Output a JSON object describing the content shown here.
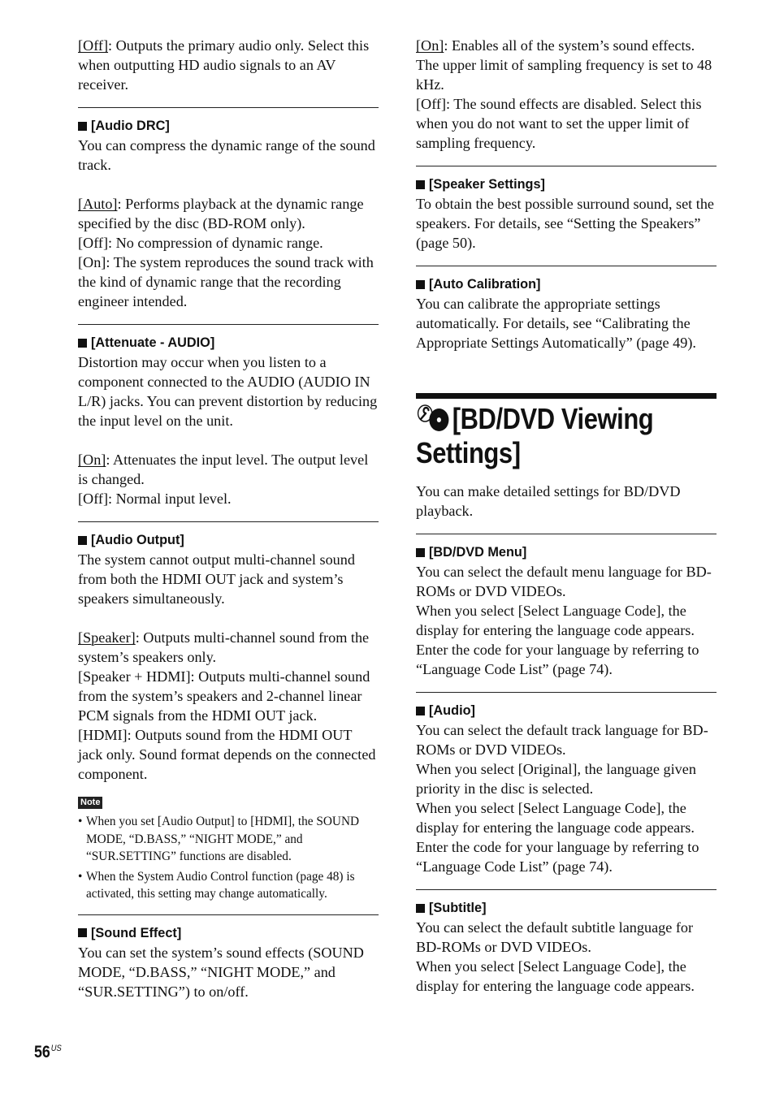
{
  "left": {
    "intro": {
      "opt": "[Off]",
      "rest": ": Outputs the primary audio only. Select this when outputting HD audio signals to an AV receiver."
    },
    "audio_drc": {
      "heading": "[Audio DRC]",
      "desc": "You can compress the dynamic range of the sound track.",
      "opt1": "[Auto]",
      "opt1_rest": ": Performs playback at the dynamic range specified by the disc (BD-ROM only).",
      "opt2": "[Off]: No compression of dynamic range.",
      "opt3": "[On]: The system reproduces the sound track with the kind of dynamic range that the recording engineer intended."
    },
    "attenuate": {
      "heading": "[Attenuate - AUDIO]",
      "desc": "Distortion may occur when you listen to a component connected to the AUDIO (AUDIO IN L/R) jacks. You can prevent distortion by reducing the input level on the unit.",
      "opt1": "[On]",
      "opt1_rest": ": Attenuates the input level. The output level is changed.",
      "opt2": "[Off]: Normal input level."
    },
    "audio_output": {
      "heading": "[Audio Output]",
      "desc": "The system cannot output multi-channel sound from both the HDMI OUT jack and system’s speakers simultaneously.",
      "opt1": "[Speaker]",
      "opt1_rest": ": Outputs multi-channel sound from the system’s speakers only.",
      "opt2": "[Speaker + HDMI]: Outputs multi-channel sound from the system’s speakers and 2-channel linear PCM signals from the HDMI OUT jack.",
      "opt3": "[HDMI]: Outputs sound from the HDMI OUT jack only. Sound format depends on the connected component.",
      "note_label": "Note",
      "notes": [
        "When you set [Audio Output] to [HDMI], the SOUND MODE, “D.BASS,” “NIGHT MODE,” and “SUR.SETTING” functions are disabled.",
        "When the System Audio Control function (page 48) is activated, this setting may change automatically."
      ]
    },
    "sound_effect": {
      "heading": "[Sound Effect]",
      "desc": "You can set the system’s sound effects (SOUND MODE, “D.BASS,” “NIGHT MODE,” and “SUR.SETTING”) to on/off."
    }
  },
  "right": {
    "sound_effect_cont": {
      "opt1": "[On]",
      "opt1_rest": ": Enables all of the system’s sound effects. The upper limit of sampling frequency is set to 48 kHz.",
      "opt2": "[Off]: The sound effects are disabled. Select this when you do not want to set the upper limit of sampling frequency."
    },
    "speaker_settings": {
      "heading": "[Speaker Settings]",
      "desc": "To obtain the best possible surround sound, set the speakers. For details, see “Setting the Speakers” (page 50)."
    },
    "auto_calibration": {
      "heading": "[Auto Calibration]",
      "desc": "You can calibrate the appropriate settings automatically. For details, see “Calibrating the Appropriate Settings Automatically” (page 49)."
    },
    "section": {
      "icon": "wrench-disc-icon",
      "title": "[BD/DVD Viewing Settings]",
      "intro": "You can make detailed settings for BD/DVD playback."
    },
    "bd_dvd_menu": {
      "heading": "[BD/DVD Menu]",
      "desc": "You can select the default menu language for BD-ROMs or DVD VIDEOs.",
      "p2": "When you select [Select Language Code], the display for entering the language code appears. Enter the code for your language by referring to “Language Code List” (page 74)."
    },
    "audio": {
      "heading": "[Audio]",
      "desc": "You can select the default track language for BD-ROMs or DVD VIDEOs.",
      "p2": "When you select [Original], the language given priority in the disc is selected.",
      "p3": "When you select [Select Language Code], the display for entering the language code appears. Enter the code for your language by referring to “Language Code List” (page 74)."
    },
    "subtitle": {
      "heading": "[Subtitle]",
      "desc": "You can select the default subtitle language for BD-ROMs or DVD VIDEOs.",
      "p2": "When you select [Select Language Code], the display for entering the language code appears."
    }
  },
  "footer": {
    "page_number": "56",
    "region": "US"
  }
}
